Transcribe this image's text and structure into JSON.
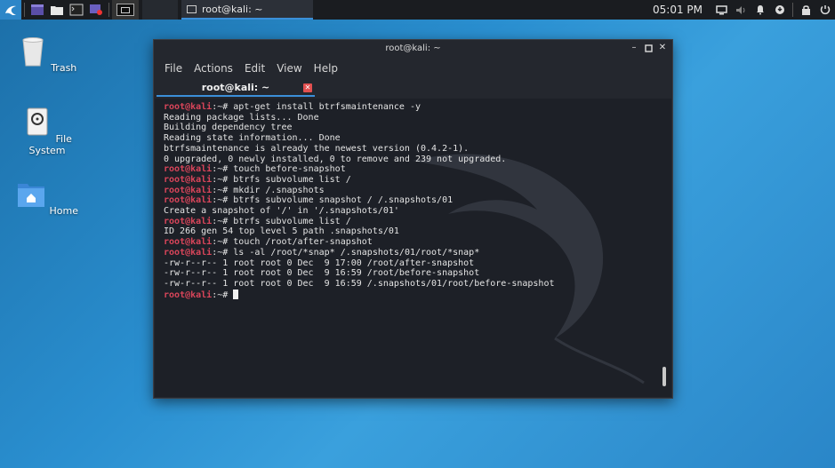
{
  "panel": {
    "clock": "05:01 PM",
    "task_title": "root@kali: ~"
  },
  "desktop": {
    "icons": [
      {
        "label": "Trash"
      },
      {
        "label": "File System"
      },
      {
        "label": "Home"
      }
    ]
  },
  "window": {
    "title": "root@kali: ~",
    "menu": [
      "File",
      "Actions",
      "Edit",
      "View",
      "Help"
    ],
    "tab_label": "root@kali: ~"
  },
  "terminal": {
    "prompt_user": "root@kali",
    "prompt_sep": ":~# ",
    "lines": [
      {
        "prompt": true,
        "text": "apt-get install btrfsmaintenance -y"
      },
      {
        "prompt": false,
        "text": "Reading package lists... Done"
      },
      {
        "prompt": false,
        "text": "Building dependency tree"
      },
      {
        "prompt": false,
        "text": "Reading state information... Done"
      },
      {
        "prompt": false,
        "text": "btrfsmaintenance is already the newest version (0.4.2-1)."
      },
      {
        "prompt": false,
        "text": "0 upgraded, 0 newly installed, 0 to remove and 239 not upgraded."
      },
      {
        "prompt": true,
        "text": "touch before-snapshot"
      },
      {
        "prompt": true,
        "text": "btrfs subvolume list /"
      },
      {
        "prompt": true,
        "text": "mkdir /.snapshots"
      },
      {
        "prompt": true,
        "text": "btrfs subvolume snapshot / /.snapshots/01"
      },
      {
        "prompt": false,
        "text": "Create a snapshot of '/' in '/.snapshots/01'"
      },
      {
        "prompt": true,
        "text": "btrfs subvolume list /"
      },
      {
        "prompt": false,
        "text": "ID 266 gen 54 top level 5 path .snapshots/01"
      },
      {
        "prompt": true,
        "text": "touch /root/after-snapshot"
      },
      {
        "prompt": true,
        "text": "ls -al /root/*snap* /.snapshots/01/root/*snap*"
      },
      {
        "prompt": false,
        "text": "-rw-r--r-- 1 root root 0 Dec  9 17:00 /root/after-snapshot"
      },
      {
        "prompt": false,
        "text": "-rw-r--r-- 1 root root 0 Dec  9 16:59 /root/before-snapshot"
      },
      {
        "prompt": false,
        "text": "-rw-r--r-- 1 root root 0 Dec  9 16:59 /.snapshots/01/root/before-snapshot"
      },
      {
        "prompt": true,
        "text": ""
      }
    ]
  },
  "colors": {
    "prompt": "#d9455a",
    "accent": "#3b8fd9"
  }
}
